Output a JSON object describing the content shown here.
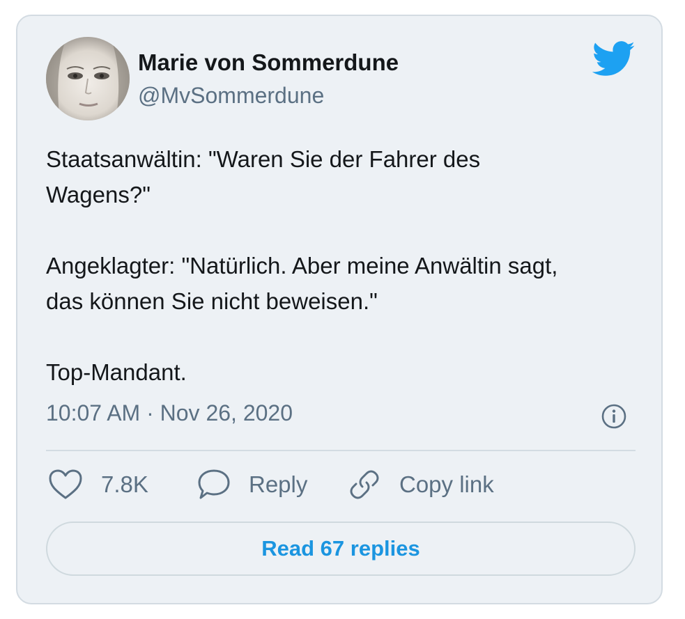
{
  "user": {
    "display_name": "Marie von Sommerdune",
    "handle": "@MvSommerdune",
    "avatar_icon": "profile-photo"
  },
  "brand": {
    "icon": "twitter-bird-icon",
    "color": "#1da1f2"
  },
  "tweet": {
    "lines": [
      "Staatsanwältin: \"Waren Sie der Fahrer des",
      "Wagens?\"",
      "Angeklagter: \"Natürlich. Aber meine Anwältin sagt,",
      "das können Sie nicht beweisen.\"",
      "Top-Mandant."
    ],
    "timestamp": "10:07 AM · Nov 26, 2020"
  },
  "actions": {
    "like_count": "7.8K",
    "reply_label": "Reply",
    "copy_link_label": "Copy link"
  },
  "read_replies_label": "Read 67 replies",
  "colors": {
    "card_bg": "#edf1f5",
    "secondary_text": "#5b7083",
    "link_blue": "#1b95e0"
  }
}
